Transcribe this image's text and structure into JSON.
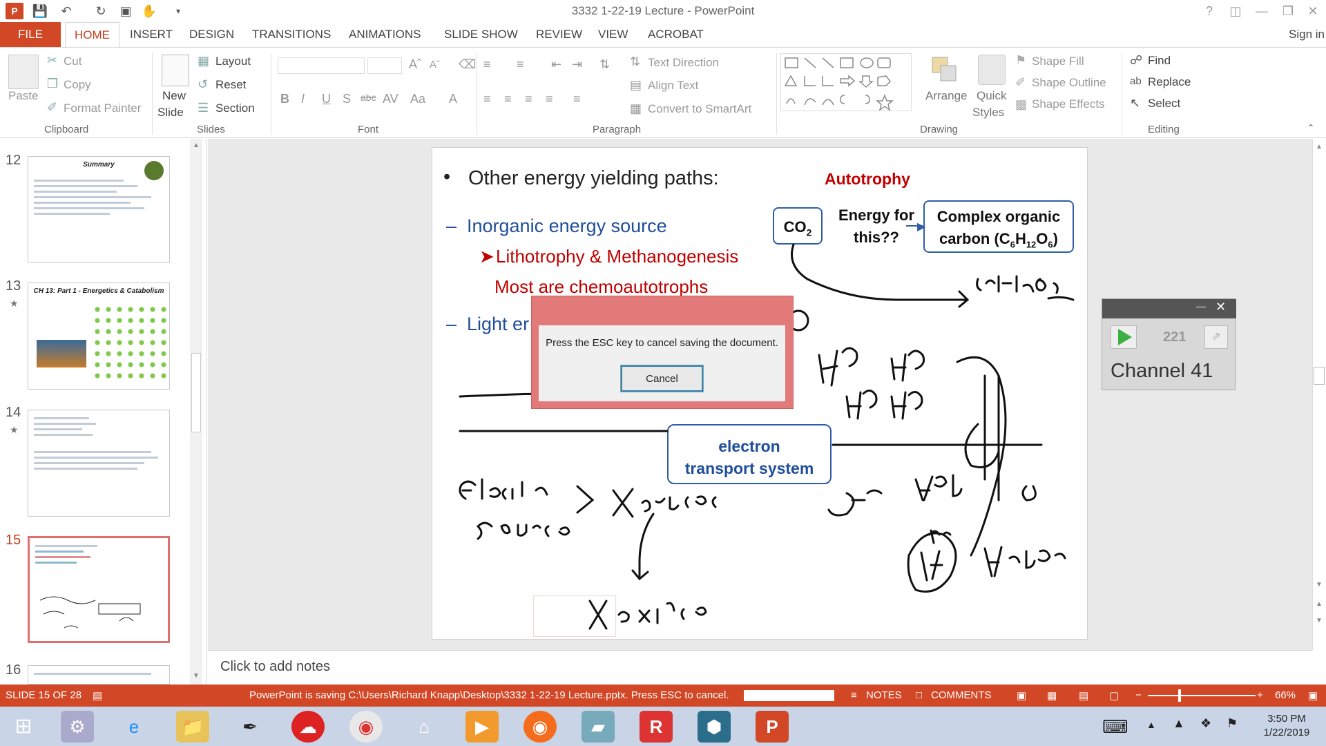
{
  "window": {
    "title": "3332 1-22-19 Lecture - PowerPoint",
    "sign_in": "Sign in"
  },
  "tabs": [
    "FILE",
    "HOME",
    "INSERT",
    "DESIGN",
    "TRANSITIONS",
    "ANIMATIONS",
    "SLIDE SHOW",
    "REVIEW",
    "VIEW",
    "ACROBAT"
  ],
  "ribbon": {
    "clipboard": {
      "paste": "Paste",
      "cut": "Cut",
      "copy": "Copy",
      "format_painter": "Format Painter",
      "label": "Clipboard"
    },
    "slides": {
      "new_slide_1": "New",
      "new_slide_2": "Slide",
      "layout": "Layout",
      "reset": "Reset",
      "section": "Section",
      "label": "Slides"
    },
    "font": {
      "label": "Font"
    },
    "paragraph": {
      "text_direction": "Text Direction",
      "align_text": "Align Text",
      "convert_smartart": "Convert to SmartArt",
      "label": "Paragraph"
    },
    "drawing": {
      "arrange": "Arrange",
      "quick_styles_1": "Quick",
      "quick_styles_2": "Styles",
      "shape_fill": "Shape Fill",
      "shape_outline": "Shape Outline",
      "shape_effects": "Shape Effects",
      "label": "Drawing"
    },
    "editing": {
      "find": "Find",
      "replace": "Replace",
      "select": "Select",
      "label": "Editing"
    }
  },
  "thumbnails": [
    {
      "num": "12",
      "title": "Summary"
    },
    {
      "num": "13",
      "title": "CH 13: Part 1 - Energetics & Catabolism"
    },
    {
      "num": "14",
      "title": ""
    },
    {
      "num": "15",
      "title": ""
    },
    {
      "num": "16",
      "title": ""
    }
  ],
  "slide": {
    "bullet1": "Other energy yielding paths:",
    "dash1": "Inorganic energy source",
    "sub1": "Lithotrophy & Methanogenesis",
    "sub2": "Most are chemoautotrophs",
    "dash2": "Light er",
    "autotrophy": "Autotrophy",
    "co2": "CO",
    "co2_sub": "2",
    "energy_for": "Energy for",
    "this": "this??",
    "complex1": "Complex organic",
    "complex2": "carbon (C",
    "complex2_sub1": "6",
    "complex2_h": "H",
    "complex2_sub2": "12",
    "complex2_o": "O",
    "complex2_sub3": "6",
    "complex2_end": ")",
    "ets1": "electron",
    "ets2": "transport system"
  },
  "notes": {
    "placeholder": "Click to add notes"
  },
  "dialog": {
    "message": "Press the ESC key to cancel saving the document.",
    "cancel": "Cancel"
  },
  "channel": {
    "count": "221",
    "name": "Channel 41"
  },
  "status": {
    "slide": "SLIDE 15 OF 28",
    "saving": "PowerPoint is saving C:\\Users\\Richard Knapp\\Desktop\\3332 1-22-19 Lecture.pptx. Press ESC to cancel.",
    "notes": "NOTES",
    "comments": "COMMENTS",
    "zoom": "66%"
  },
  "taskbar": {
    "time": "3:50 PM",
    "date": "1/22/2019"
  }
}
